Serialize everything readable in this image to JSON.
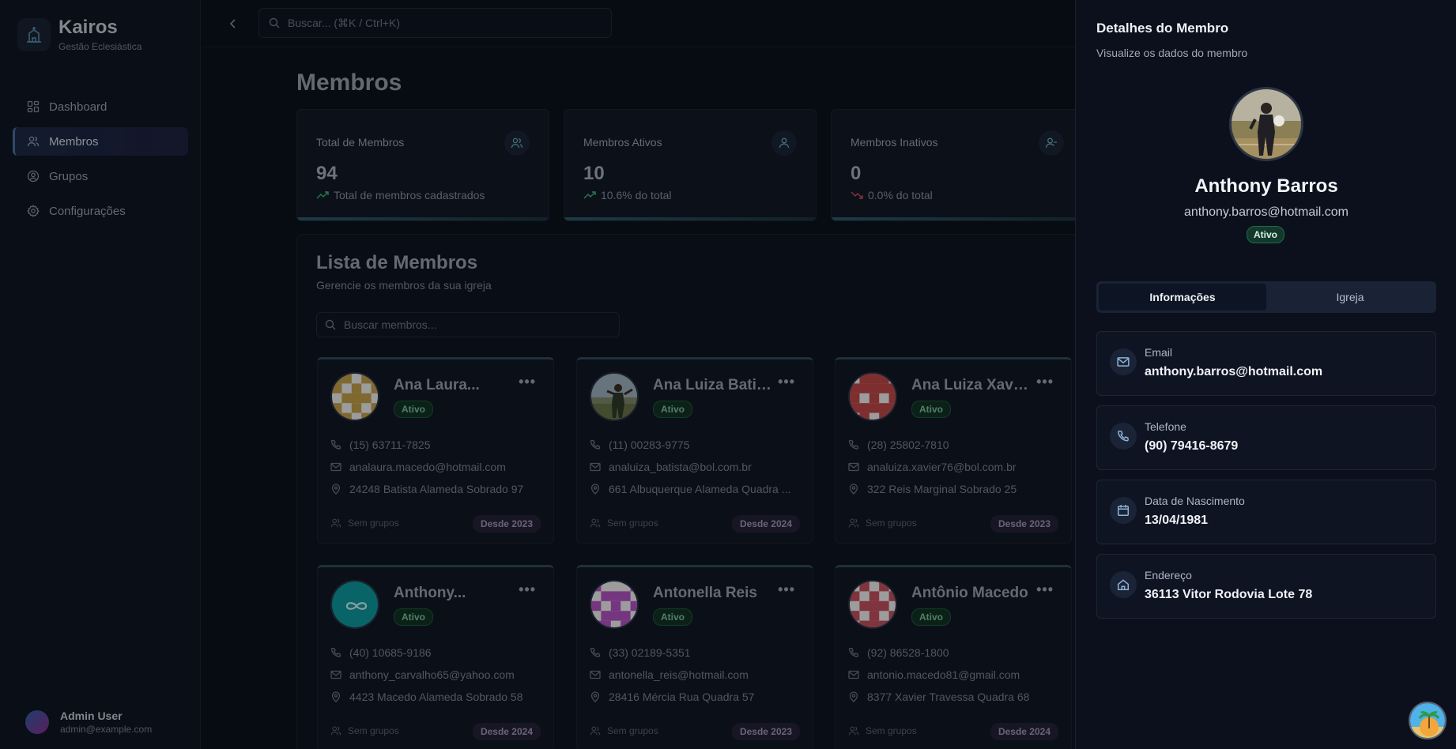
{
  "brand": {
    "name": "Kairos",
    "subtitle": "Gestão Eclesiástica"
  },
  "sidebar": {
    "items": [
      {
        "label": "Dashboard",
        "icon": "grid-icon",
        "active": false
      },
      {
        "label": "Membros",
        "icon": "users-icon",
        "active": true
      },
      {
        "label": "Grupos",
        "icon": "user-circle-icon",
        "active": false
      },
      {
        "label": "Configurações",
        "icon": "gear-icon",
        "active": false
      }
    ],
    "user": {
      "name": "Admin User",
      "email": "admin@example.com"
    }
  },
  "topbar": {
    "search_placeholder": "Buscar... (⌘K / Ctrl+K)"
  },
  "page": {
    "title": "Membros"
  },
  "stats": [
    {
      "label": "Total de Membros",
      "value": "94",
      "desc": "Total de membros cadastrados",
      "trend": "up"
    },
    {
      "label": "Membros Ativos",
      "value": "10",
      "desc": "10.6% do total",
      "trend": "up"
    },
    {
      "label": "Membros Inativos",
      "value": "0",
      "desc": "0.0% do total",
      "trend": "down"
    }
  ],
  "list": {
    "title": "Lista de Membros",
    "subtitle": "Gerencie os membros da sua igreja",
    "search_placeholder": "Buscar membros...",
    "members": [
      {
        "name": "Ana Laura...",
        "status": "Ativo",
        "phone": "(15) 63711-7825",
        "email": "analaura.macedo@hotmail.com",
        "address": "24248 Batista Alameda Sobrado 97",
        "groups": "Sem grupos",
        "since": "Desde 2023",
        "avatar": "identicon-gold"
      },
      {
        "name": "Ana Luiza Batista",
        "status": "Ativo",
        "phone": "(11) 00283-9775",
        "email": "analuiza_batista@bol.com.br",
        "address": "661 Albuquerque Alameda Quadra ...",
        "groups": "Sem grupos",
        "since": "Desde 2024",
        "avatar": "photo"
      },
      {
        "name": "Ana Luiza Xavier",
        "status": "Ativo",
        "phone": "(28) 25802-7810",
        "email": "analuiza.xavier76@bol.com.br",
        "address": "322 Reis Marginal Sobrado 25",
        "groups": "Sem grupos",
        "since": "Desde 2023",
        "avatar": "identicon-red"
      },
      {
        "name": "Anthony...",
        "status": "Ativo",
        "phone": "(40) 10685-9186",
        "email": "anthony_carvalho65@yahoo.com",
        "address": "4423 Macedo Alameda Sobrado 58",
        "groups": "Sem grupos",
        "since": "Desde 2024",
        "avatar": "infinity-teal"
      },
      {
        "name": "Antonella Reis",
        "status": "Ativo",
        "phone": "(33) 02189-5351",
        "email": "antonella_reis@hotmail.com",
        "address": "28416 Mércia Rua Quadra 57",
        "groups": "Sem grupos",
        "since": "Desde 2023",
        "avatar": "identicon-purple"
      },
      {
        "name": "Antônio Macedo",
        "status": "Ativo",
        "phone": "(92) 86528-1800",
        "email": "antonio.macedo81@gmail.com",
        "address": "8377 Xavier Travessa Quadra 68",
        "groups": "Sem grupos",
        "since": "Desde 2024",
        "avatar": "identicon-rose"
      }
    ]
  },
  "detail": {
    "title": "Detalhes do Membro",
    "subtitle": "Visualize os dados do membro",
    "name": "Anthony Barros",
    "email": "anthony.barros@hotmail.com",
    "status": "Ativo",
    "tabs": [
      "Informações",
      "Igreja"
    ],
    "active_tab": "Informações",
    "fields": [
      {
        "label": "Email",
        "value": "anthony.barros@hotmail.com",
        "icon": "mail-icon"
      },
      {
        "label": "Telefone",
        "value": "(90) 79416-8679",
        "icon": "phone-icon"
      },
      {
        "label": "Data de Nascimento",
        "value": "13/04/1981",
        "icon": "calendar-icon"
      },
      {
        "label": "Endereço",
        "value": "36113 Vitor Rodovia Lote 78",
        "icon": "home-icon"
      }
    ]
  },
  "colors": {
    "accent": "#4a6fa5",
    "status_active": "#7fc4a0",
    "background": "#0c111c",
    "panel": "#0b101c"
  }
}
